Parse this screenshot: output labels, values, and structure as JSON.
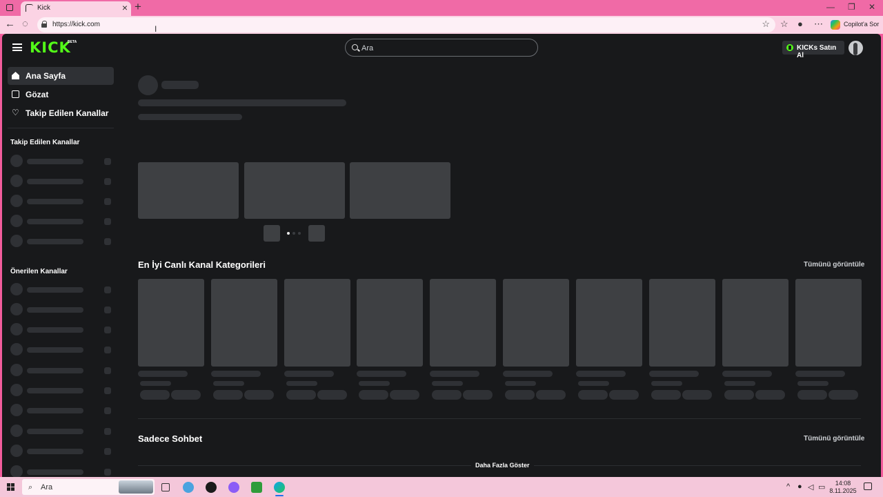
{
  "browser": {
    "tab_title": "Kick",
    "url": "https://kick.com",
    "copilot_label": "Copilot'a Sor"
  },
  "header": {
    "logo_text": "KICK",
    "beta_badge": "BETA",
    "search_placeholder": "Ara",
    "kicks_button": "KICKs Satın Al"
  },
  "sidebar": {
    "nav": [
      {
        "label": "Ana Sayfa",
        "icon": "home-icon"
      },
      {
        "label": "Gözat",
        "icon": "browse-icon"
      },
      {
        "label": "Takip Edilen Kanallar",
        "icon": "heart-icon"
      }
    ],
    "followed_heading": "Takip Edilen Kanallar",
    "recommended_heading": "Önerilen Kanallar"
  },
  "main": {
    "categories_title": "En İyi Canlı Kanal Kategorileri",
    "categories_view_all": "Tümünü görüntüle",
    "chat_title": "Sadece Sohbet",
    "chat_view_all": "Tümünü görüntüle",
    "show_more": "Daha Fazla Göster"
  },
  "taskbar": {
    "search_label": "Ara",
    "time": "14:08",
    "date": "8.11.2025"
  },
  "colors": {
    "brand": "#53fc18",
    "page_bg": "#18191b",
    "skeleton": "#2f3135",
    "chrome": "#f06aa6"
  }
}
